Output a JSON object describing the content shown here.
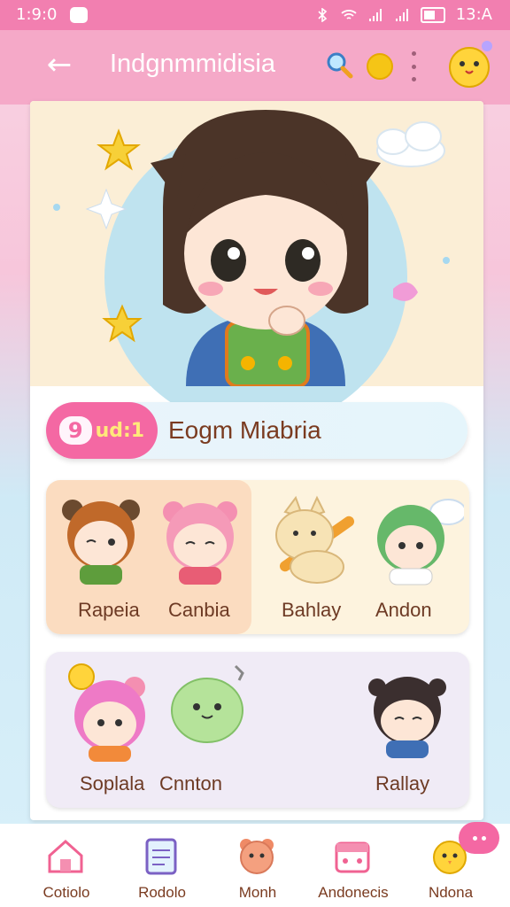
{
  "status_bar": {
    "time": "1:9:0",
    "clock_right": "13:A"
  },
  "app_bar": {
    "title": "Indgnmmidisia"
  },
  "banner": {
    "badge": "9",
    "badge_tag": "ud:1",
    "title": "Eogm Miabria"
  },
  "characters_row1": [
    {
      "label": "Rapeia"
    },
    {
      "label": "Canbia"
    },
    {
      "label": "Bahlay"
    },
    {
      "label": "Andon"
    }
  ],
  "characters_row2": [
    {
      "label": "Soplala"
    },
    {
      "label": "Cnnton"
    },
    {
      "label": "Rallay"
    }
  ],
  "bottom_nav": [
    {
      "label": "Cotiolo"
    },
    {
      "label": "Rodolo"
    },
    {
      "label": "Monh"
    },
    {
      "label": "Andonecis"
    },
    {
      "label": "Ndona"
    }
  ],
  "colors": {
    "accent": "#f468a3",
    "appbar": "#f5a9c8",
    "status": "#f27fb0",
    "text_brown": "#7a3b20"
  }
}
